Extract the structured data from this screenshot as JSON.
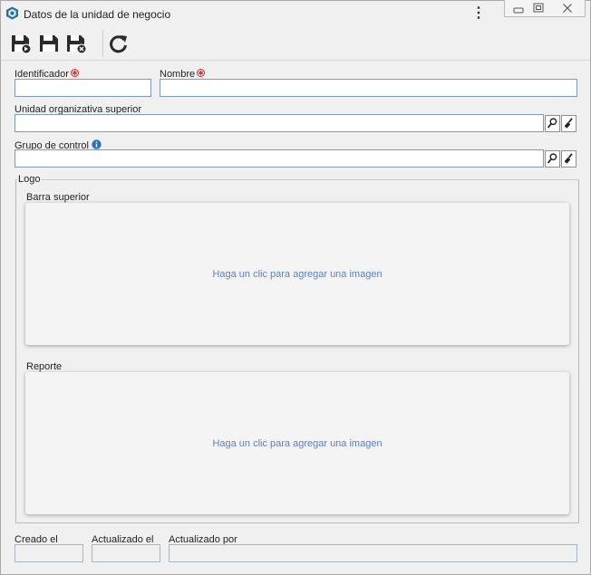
{
  "window": {
    "title": "Datos de la unidad de negocio",
    "menu_glyph": "⋮"
  },
  "toolbar": {
    "buttons": [
      {
        "name": "save-and-new-icon"
      },
      {
        "name": "save-icon"
      },
      {
        "name": "save-and-close-icon"
      },
      {
        "name": "refresh-icon"
      }
    ]
  },
  "form": {
    "identificador": {
      "label": "Identificador",
      "value": ""
    },
    "nombre": {
      "label": "Nombre",
      "value": ""
    },
    "unidad_superior": {
      "label": "Unidad organizativa superior",
      "value": ""
    },
    "grupo_control": {
      "label": "Grupo de control",
      "value": ""
    }
  },
  "logo": {
    "legend": "Logo",
    "barra_superior": {
      "label": "Barra superior",
      "prompt": "Haga un clic para agregar una imagen"
    },
    "reporte": {
      "label": "Reporte",
      "prompt": "Haga un clic para agregar una imagen"
    }
  },
  "footer": {
    "creado": {
      "label": "Creado el",
      "value": ""
    },
    "actualizado": {
      "label": "Actualizado el",
      "value": ""
    },
    "actualizado_por": {
      "label": "Actualizado por",
      "value": ""
    }
  },
  "colors": {
    "required": "#d9262a",
    "info": "#2a6fc9",
    "link_text": "#5b7fc8",
    "input_border": "#7d9bbb"
  }
}
